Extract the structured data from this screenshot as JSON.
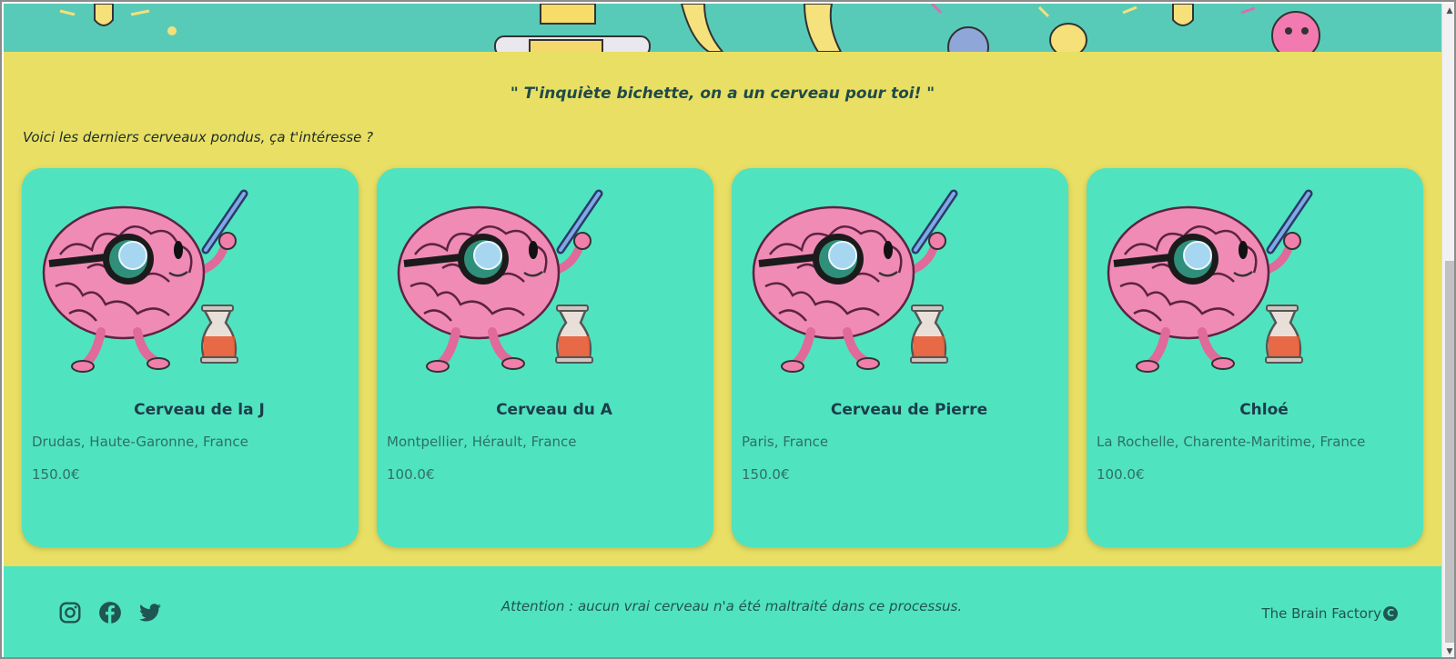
{
  "quote": "\" T'inquiète bichette, on a un cerveau pour toi! \"",
  "intro": "Voici les derniers cerveaux pondus, ça t'intéresse ?",
  "cards": [
    {
      "title": "Cerveau de la J",
      "location": "Drudas, Haute-Garonne, France",
      "price": "150.0€"
    },
    {
      "title": "Cerveau du A",
      "location": "Montpellier, Hérault, France",
      "price": "100.0€"
    },
    {
      "title": "Cerveau de Pierre",
      "location": "Paris, France",
      "price": "150.0€"
    },
    {
      "title": "Chloé",
      "location": "La Rochelle, Charente-Maritime, France",
      "price": "100.0€"
    }
  ],
  "footer": {
    "note": "Attention : aucun vrai cerveau n'a été maltraité dans ce processus.",
    "brand": "The Brain Factory",
    "copyright_symbol": "C",
    "social_icons": [
      "instagram-icon",
      "facebook-icon",
      "twitter-icon"
    ]
  },
  "colors": {
    "main_bg": "#e8df64",
    "card_bg": "#50e3bf",
    "footer_bg": "#50e3bf",
    "text_dark": "#1c3d4a"
  }
}
